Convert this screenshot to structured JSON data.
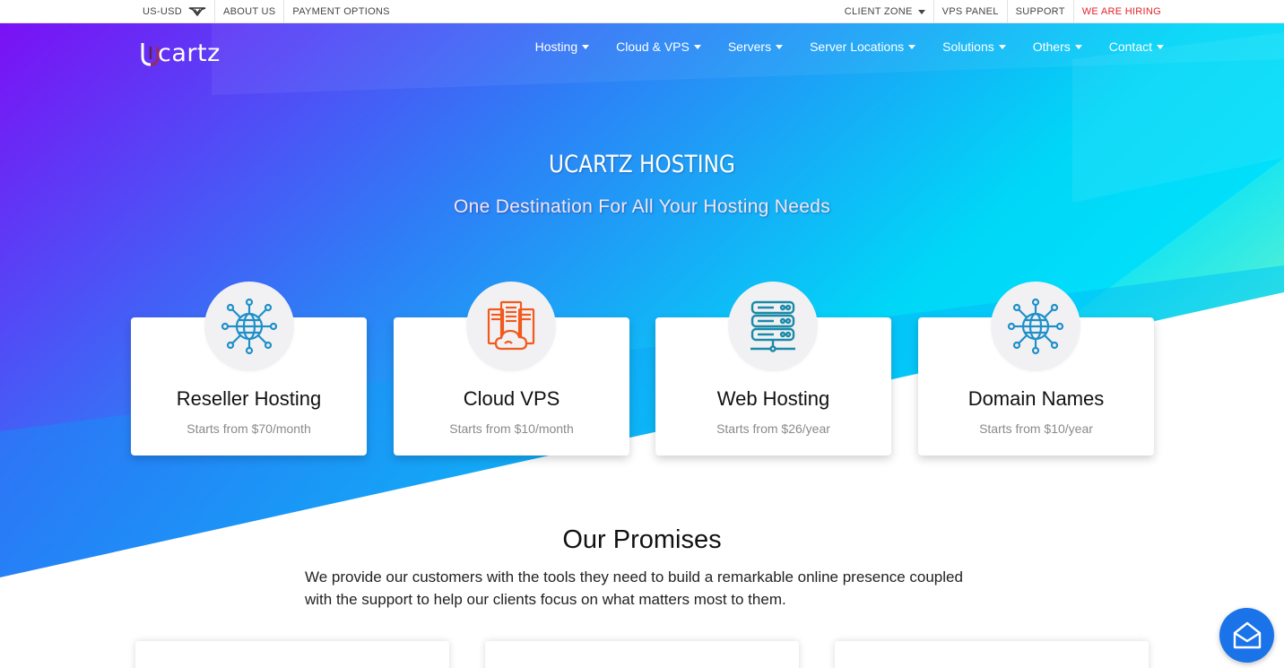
{
  "topbar": {
    "currency": "US-USD",
    "about": "ABOUT US",
    "payment": "PAYMENT OPTIONS",
    "client_zone": "CLIENT ZONE",
    "vps_panel": "VPS PANEL",
    "support": "SUPPORT",
    "hiring": "WE ARE HIRING",
    "hiring_color": "#e0242b"
  },
  "logo": {
    "text": "cartz"
  },
  "nav": {
    "items": [
      {
        "label": "Hosting"
      },
      {
        "label": "Cloud & VPS"
      },
      {
        "label": "Servers"
      },
      {
        "label": "Server Locations"
      },
      {
        "label": "Solutions"
      },
      {
        "label": "Others"
      },
      {
        "label": "Contact"
      }
    ]
  },
  "hero": {
    "title": "UCARTZ HOSTING",
    "subtitle": "One Destination For All Your Hosting Needs",
    "colors": {
      "violet": "#7b10f5",
      "blue": "#2f7df6",
      "cyan": "#00e0ff",
      "mint": "#6ff5c8"
    }
  },
  "cards": [
    {
      "title": "Reseller Hosting",
      "price": "Starts from $70/month",
      "icon": "globe-network-icon"
    },
    {
      "title": "Cloud VPS",
      "price": "Starts from $10/month",
      "icon": "cloud-server-icon"
    },
    {
      "title": "Web Hosting",
      "price": "Starts from $26/year",
      "icon": "server-rack-icon"
    },
    {
      "title": "Domain Names",
      "price": "Starts from $10/year",
      "icon": "globe-network-icon"
    }
  ],
  "promises": {
    "title": "Our Promises",
    "text": "We provide our customers with the tools they need to build a remarkable online presence coupled with the support to help our clients focus on what matters most to them."
  },
  "chat": {
    "icon": "envelope-chat-icon",
    "color": "#1a73e8"
  }
}
